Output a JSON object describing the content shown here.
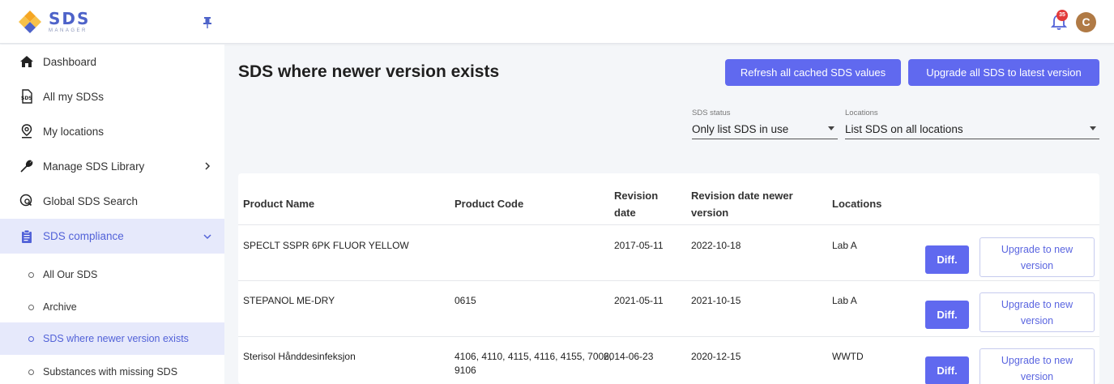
{
  "header": {
    "logo_text": "SDS",
    "logo_sub": "MANAGER",
    "notification_count": "35",
    "avatar_initial": "C",
    "icons": {
      "pin": "pin-icon",
      "bell": "bell-icon"
    }
  },
  "sidebar": {
    "items": [
      {
        "label": "Dashboard",
        "icon": "home-icon"
      },
      {
        "label": "All my SDSs",
        "icon": "sds-file-icon"
      },
      {
        "label": "My locations",
        "icon": "location-pin-icon"
      },
      {
        "label": "Manage SDS Library",
        "icon": "wrench-icon"
      },
      {
        "label": "Global SDS Search",
        "icon": "globe-search-icon"
      },
      {
        "label": "SDS compliance",
        "icon": "clipboard-icon"
      }
    ],
    "sub_items": [
      {
        "label": "All Our SDS"
      },
      {
        "label": "Archive"
      },
      {
        "label": "SDS where newer version exists"
      },
      {
        "label": "Substances with missing SDS"
      }
    ]
  },
  "main": {
    "title": "SDS where newer version exists",
    "refresh_button": "Refresh all cached SDS values",
    "upgrade_all_button": "Upgrade all SDS to latest version",
    "filters": {
      "status_label": "SDS status",
      "status_value": "Only list SDS in use",
      "locations_label": "Locations",
      "locations_value": "List SDS on all locations"
    },
    "table": {
      "headers": {
        "product_name": "Product Name",
        "product_code": "Product Code",
        "revision_date_1": "Revision",
        "revision_date_2": "date",
        "newer_1": "Revision date newer",
        "newer_2": "version",
        "locations": "Locations"
      },
      "rows": [
        {
          "name": "SPECLT SSPR 6PK FLUOR YELLOW",
          "code_1": "",
          "code_2": "",
          "revision": "2017-05-11",
          "newer": "2022-10-18",
          "location": "Lab A",
          "diff": "Diff.",
          "upgrade_1": "Upgrade to new",
          "upgrade_2": "version"
        },
        {
          "name": "STEPANOL ME-DRY",
          "code_1": "0615",
          "code_2": "",
          "revision": "2021-05-11",
          "newer": "2021-10-15",
          "location": "Lab A",
          "diff": "Diff.",
          "upgrade_1": "Upgrade to new",
          "upgrade_2": "version"
        },
        {
          "name": "Sterisol Hånddesinfeksjon",
          "code_1": "4106, 4110, 4115, 4116, 4155, 7006,",
          "code_2": "9106",
          "revision": "2014-06-23",
          "newer": "2020-12-15",
          "location": "WWTD",
          "diff": "Diff.",
          "upgrade_1": "Upgrade to new",
          "upgrade_2": "version"
        }
      ]
    }
  },
  "colors": {
    "accent": "#6069ef",
    "active_bg": "#e6e9fb",
    "badge": "#e23a3a",
    "avatar": "#b07a45",
    "logo_orange": "#f5a623"
  }
}
